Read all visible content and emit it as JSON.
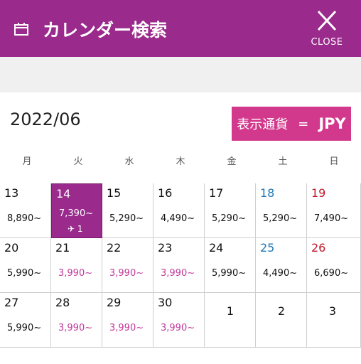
{
  "header": {
    "title": "カレンダー検索",
    "close_label": "CLOSE"
  },
  "month": "2022/06",
  "currency": {
    "label": "表示通貨",
    "equals": "=",
    "code": "JPY"
  },
  "weekdays": [
    "月",
    "火",
    "水",
    "木",
    "金",
    "土",
    "日"
  ],
  "week1": [
    {
      "day": "13",
      "price": "8,890~"
    },
    {
      "day": "14",
      "price": "7,390~",
      "flights": "✈ 1"
    },
    {
      "day": "15",
      "price": "5,290~"
    },
    {
      "day": "16",
      "price": "4,490~"
    },
    {
      "day": "17",
      "price": "5,290~"
    },
    {
      "day": "18",
      "price": "5,290~"
    },
    {
      "day": "19",
      "price": "7,490~"
    }
  ],
  "week2": [
    {
      "day": "20",
      "price": "5,990~"
    },
    {
      "day": "21",
      "price": "3,990~"
    },
    {
      "day": "22",
      "price": "3,990~"
    },
    {
      "day": "23",
      "price": "3,990~"
    },
    {
      "day": "24",
      "price": "5,990~"
    },
    {
      "day": "25",
      "price": "4,490~"
    },
    {
      "day": "26",
      "price": "6,690~"
    }
  ],
  "week3": [
    {
      "day": "27",
      "price": "5,990~"
    },
    {
      "day": "28",
      "price": "3,990~"
    },
    {
      "day": "29",
      "price": "3,990~"
    },
    {
      "day": "30",
      "price": "3,990~"
    },
    {
      "day": "1"
    },
    {
      "day": "2"
    },
    {
      "day": "3"
    }
  ]
}
